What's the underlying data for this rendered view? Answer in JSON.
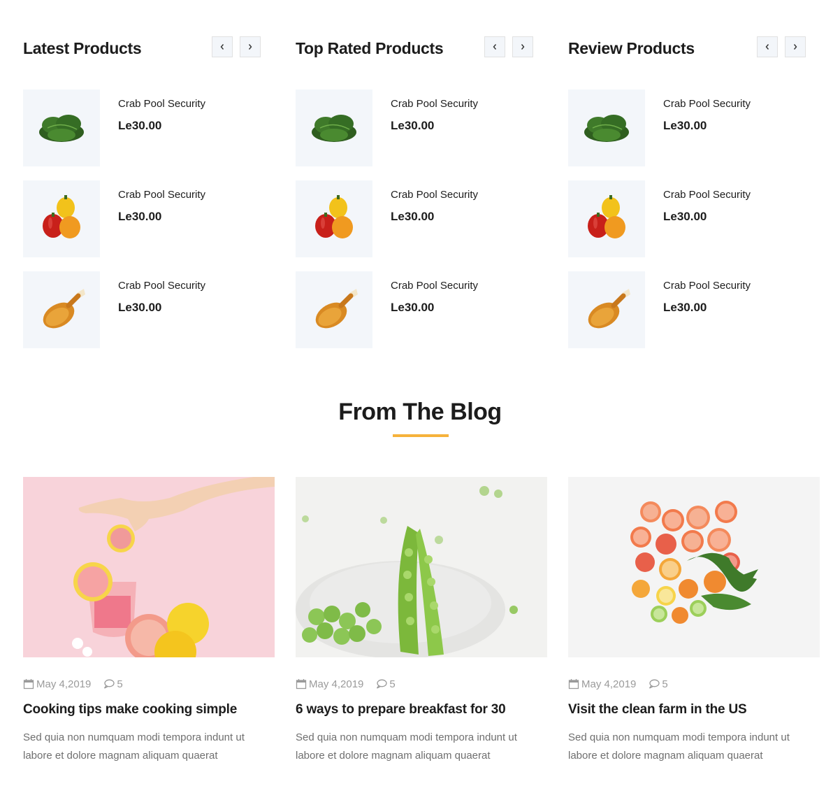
{
  "product_columns": [
    {
      "title": "Latest Products",
      "items": [
        {
          "name": "Crab Pool Security",
          "price": "Le30.00",
          "image": "spinach-image"
        },
        {
          "name": "Crab Pool Security",
          "price": "Le30.00",
          "image": "bell-peppers-image"
        },
        {
          "name": "Crab Pool Security",
          "price": "Le30.00",
          "image": "fried-chicken-leg-image"
        }
      ]
    },
    {
      "title": "Top Rated Products",
      "items": [
        {
          "name": "Crab Pool Security",
          "price": "Le30.00",
          "image": "spinach-image"
        },
        {
          "name": "Crab Pool Security",
          "price": "Le30.00",
          "image": "bell-peppers-image"
        },
        {
          "name": "Crab Pool Security",
          "price": "Le30.00",
          "image": "fried-chicken-leg-image"
        }
      ]
    },
    {
      "title": "Review Products",
      "items": [
        {
          "name": "Crab Pool Security",
          "price": "Le30.00",
          "image": "spinach-image"
        },
        {
          "name": "Crab Pool Security",
          "price": "Le30.00",
          "image": "bell-peppers-image"
        },
        {
          "name": "Crab Pool Security",
          "price": "Le30.00",
          "image": "fried-chicken-leg-image"
        }
      ]
    }
  ],
  "nav_icons": {
    "prev": "chevron-left-icon",
    "next": "chevron-right-icon"
  },
  "blog": {
    "title": "From The Blog",
    "accent_color": "#f6b23b",
    "posts": [
      {
        "date": "May 4,2019",
        "comments": "5",
        "title": "Cooking tips make cooking simple",
        "excerpt": "Sed quia non numquam modi tempora indunt ut labore et dolore magnam aliquam quaerat",
        "image": "grapefruit-drink-image"
      },
      {
        "date": "May 4,2019",
        "comments": "5",
        "title": "6 ways to prepare breakfast for 30",
        "excerpt": "Sed quia non numquam modi tempora indunt ut labore et dolore magnam aliquam quaerat",
        "image": "green-peas-image"
      },
      {
        "date": "May 4,2019",
        "comments": "5",
        "title": "Visit the clean farm in the US",
        "excerpt": "Sed quia non numquam modi tempora indunt ut labore et dolore magnam aliquam quaerat",
        "image": "citrus-fruits-image"
      }
    ]
  },
  "meta_icons": {
    "date": "calendar-icon",
    "comments": "comment-icon"
  }
}
